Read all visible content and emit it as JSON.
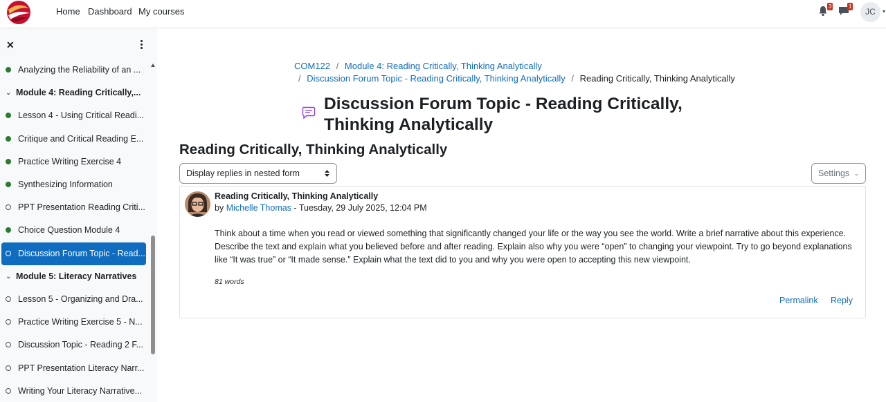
{
  "navbar": {
    "links": [
      "Home",
      "Dashboard",
      "My courses"
    ],
    "notifications_count": "3",
    "messages_count": "1",
    "user_initials": "JC"
  },
  "sidebar": {
    "items": [
      {
        "label": "Analyzing the Reliability of an ...",
        "type": "activity",
        "status": "done"
      },
      {
        "label": "Module 4: Reading Critically,...",
        "type": "section"
      },
      {
        "label": "Lesson 4 - Using Critical Readi...",
        "type": "activity",
        "status": "done"
      },
      {
        "label": "Critique and Critical Reading E...",
        "type": "activity",
        "status": "done"
      },
      {
        "label": "Practice Writing Exercise 4",
        "type": "activity",
        "status": "done"
      },
      {
        "label": "Synthesizing Information",
        "type": "activity",
        "status": "done"
      },
      {
        "label": "PPT Presentation Reading Criti...",
        "type": "activity",
        "status": "open"
      },
      {
        "label": "Choice Question Module 4",
        "type": "activity",
        "status": "done"
      },
      {
        "label": "Discussion Forum Topic - Read...",
        "type": "activity",
        "status": "open",
        "active": true
      },
      {
        "label": "Module 5: Literacy Narratives",
        "type": "section"
      },
      {
        "label": "Lesson 5 - Organizing and Dra...",
        "type": "activity",
        "status": "open"
      },
      {
        "label": "Practice Writing Exercise 5 - N...",
        "type": "activity",
        "status": "open"
      },
      {
        "label": "Discussion Topic - Reading 2 F...",
        "type": "activity",
        "status": "open"
      },
      {
        "label": "PPT Presentation Literacy Narr...",
        "type": "activity",
        "status": "open"
      },
      {
        "label": "Writing Your Literacy Narrative...",
        "type": "activity",
        "status": "open"
      }
    ]
  },
  "breadcrumb": {
    "course": "COM122",
    "separator": "/",
    "module": "Module 4: Reading Critically, Thinking Analytically",
    "forum": "Discussion Forum Topic - Reading Critically, Thinking Analytically",
    "current": "Reading Critically, Thinking Analytically"
  },
  "page": {
    "title": "Discussion Forum Topic - Reading Critically, Thinking Analytically",
    "discussion_title": "Reading Critically, Thinking Analytically",
    "display_mode": "Display replies in nested form",
    "settings_label": "Settings"
  },
  "post": {
    "subject": "Reading Critically, Thinking Analytically",
    "by_prefix": "by",
    "author": "Michelle Thomas",
    "date": " - Tuesday, 29 July 2025, 12:04 PM",
    "body": "Think about a time when you read or viewed something that significantly changed your life or the way you see the world. Write a brief narrative about this experience. Describe the text and explain what you believed before and after reading. Explain also why you were “open” to changing your viewpoint. Try to go beyond explanations like “It was true” or “It made sense.” Explain what the text did to you and why you were open to accepting this new viewpoint.",
    "word_count": "81 words",
    "permalink_label": "Permalink",
    "reply_label": "Reply"
  },
  "colors": {
    "link": "#0f6cbf",
    "active_bg": "#0f6cbf",
    "complete_dot": "#2a7b2f",
    "badge": "#ca3120"
  }
}
